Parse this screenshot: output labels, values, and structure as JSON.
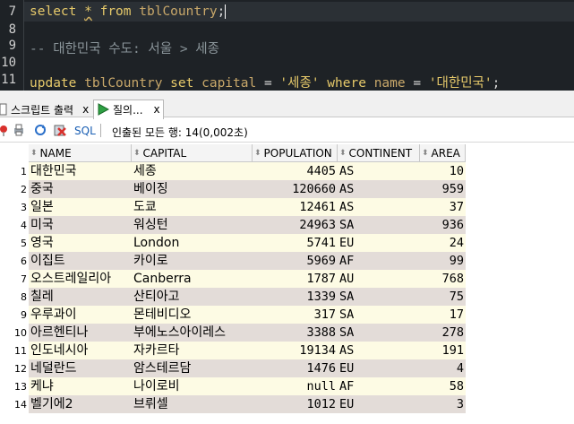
{
  "editor": {
    "lines": [
      {
        "num": "7"
      },
      {
        "num": "8"
      },
      {
        "num": "9",
        "comment": "-- 대한민국 수도: 서울 > 세종"
      },
      {
        "num": "10"
      },
      {
        "num": "11"
      }
    ],
    "line7": {
      "kw1": "select",
      "star": "*",
      "kw2": "from",
      "table": "tblCountry",
      "semi": ";"
    },
    "line11": {
      "kw1": "update",
      "table": "tblCountry",
      "kw2": "set",
      "col1": "capital",
      "eq1": "=",
      "val1": "'세종'",
      "kw3": "where",
      "col2": "name",
      "eq2": "=",
      "val2": "'대한민국'",
      "semi": ";"
    }
  },
  "tabs": [
    {
      "label": "스크립트 출력",
      "close": "x"
    },
    {
      "label": "질의...",
      "close": "x"
    }
  ],
  "toolbar": {
    "sql_label": "SQL",
    "status": "인출된 모든 행: 14(0,002초)"
  },
  "grid": {
    "columns": [
      "NAME",
      "CAPITAL",
      "POPULATION",
      "CONTINENT",
      "AREA"
    ],
    "rows": [
      {
        "n": "1",
        "name": "대한민국",
        "capital": "세종",
        "population": "4405",
        "continent": "AS",
        "area": "10"
      },
      {
        "n": "2",
        "name": "중국",
        "capital": "베이징",
        "population": "120660",
        "continent": "AS",
        "area": "959"
      },
      {
        "n": "3",
        "name": "일본",
        "capital": "도쿄",
        "population": "12461",
        "continent": "AS",
        "area": "37"
      },
      {
        "n": "4",
        "name": "미국",
        "capital": "워싱턴",
        "population": "24963",
        "continent": "SA",
        "area": "936"
      },
      {
        "n": "5",
        "name": "영국",
        "capital": "London",
        "population": "5741",
        "continent": "EU",
        "area": "24"
      },
      {
        "n": "6",
        "name": "이집트",
        "capital": "카이로",
        "population": "5969",
        "continent": "AF",
        "area": "99"
      },
      {
        "n": "7",
        "name": "오스트레일리아",
        "capital": "Canberra",
        "population": "1787",
        "continent": "AU",
        "area": "768"
      },
      {
        "n": "8",
        "name": "칠레",
        "capital": "산티아고",
        "population": "1339",
        "continent": "SA",
        "area": "75"
      },
      {
        "n": "9",
        "name": "우루과이",
        "capital": "몬테비디오",
        "population": "317",
        "continent": "SA",
        "area": "17"
      },
      {
        "n": "10",
        "name": "아르헨티나",
        "capital": "부에노스아이레스",
        "population": "3388",
        "continent": "SA",
        "area": "278"
      },
      {
        "n": "11",
        "name": "인도네시아",
        "capital": "자카르타",
        "population": "19134",
        "continent": "AS",
        "area": "191"
      },
      {
        "n": "12",
        "name": "네덜란드",
        "capital": "암스테르담",
        "population": "1476",
        "continent": "EU",
        "area": "4"
      },
      {
        "n": "13",
        "name": "케냐",
        "capital": "나이로비",
        "population": "null",
        "continent": "AF",
        "area": "58"
      },
      {
        "n": "14",
        "name": "벨기에2",
        "capital": "브뤼셀",
        "population": "1012",
        "continent": "EU",
        "area": "3"
      }
    ]
  },
  "colors": {
    "editor_bg": "#1e2226",
    "keyword": "#e6c96a",
    "identifier": "#c9a86a",
    "comment": "#8a9499",
    "row_even_bg": "#e3dcd8",
    "row_odd_bg": "#fdfbe4",
    "sql_link": "#1a5fb4"
  }
}
